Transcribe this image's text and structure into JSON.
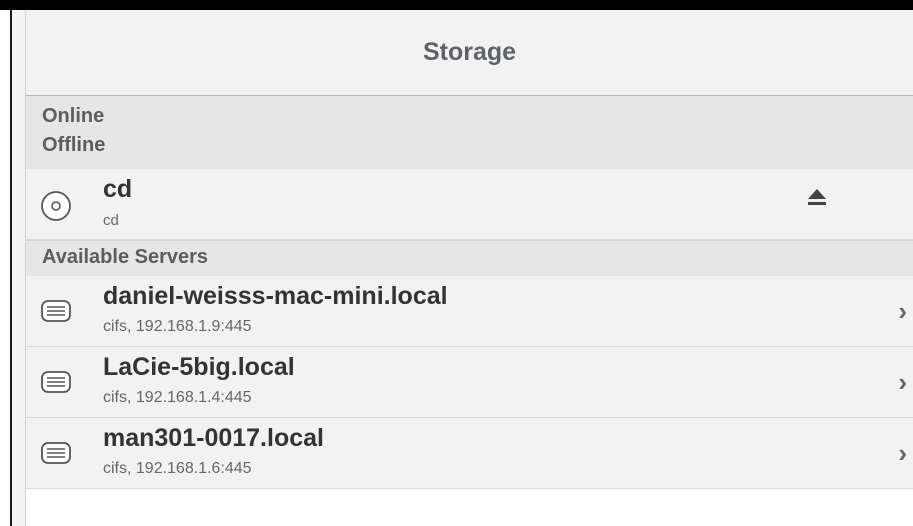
{
  "navbar": {
    "title": "Storage"
  },
  "sections": {
    "online": "Online",
    "offline": "Offline",
    "available_servers": "Available Servers"
  },
  "drives": [
    {
      "name": "cd",
      "subtitle": "cd",
      "icon": "disc-icon",
      "action_icon": "eject-icon"
    }
  ],
  "servers": [
    {
      "name": "daniel-weisss-mac-mini.local",
      "detail": "cifs, 192.168.1.9:445",
      "icon": "server-icon"
    },
    {
      "name": "LaCie-5big.local",
      "detail": "cifs, 192.168.1.4:445",
      "icon": "server-icon"
    },
    {
      "name": "man301-0017.local",
      "detail": "cifs, 192.168.1.6:445",
      "icon": "server-icon"
    }
  ],
  "colors": {
    "background": "#f2f2f2",
    "section_header": "#e6e6e6",
    "text": "#333333",
    "muted_text": "#666666"
  }
}
